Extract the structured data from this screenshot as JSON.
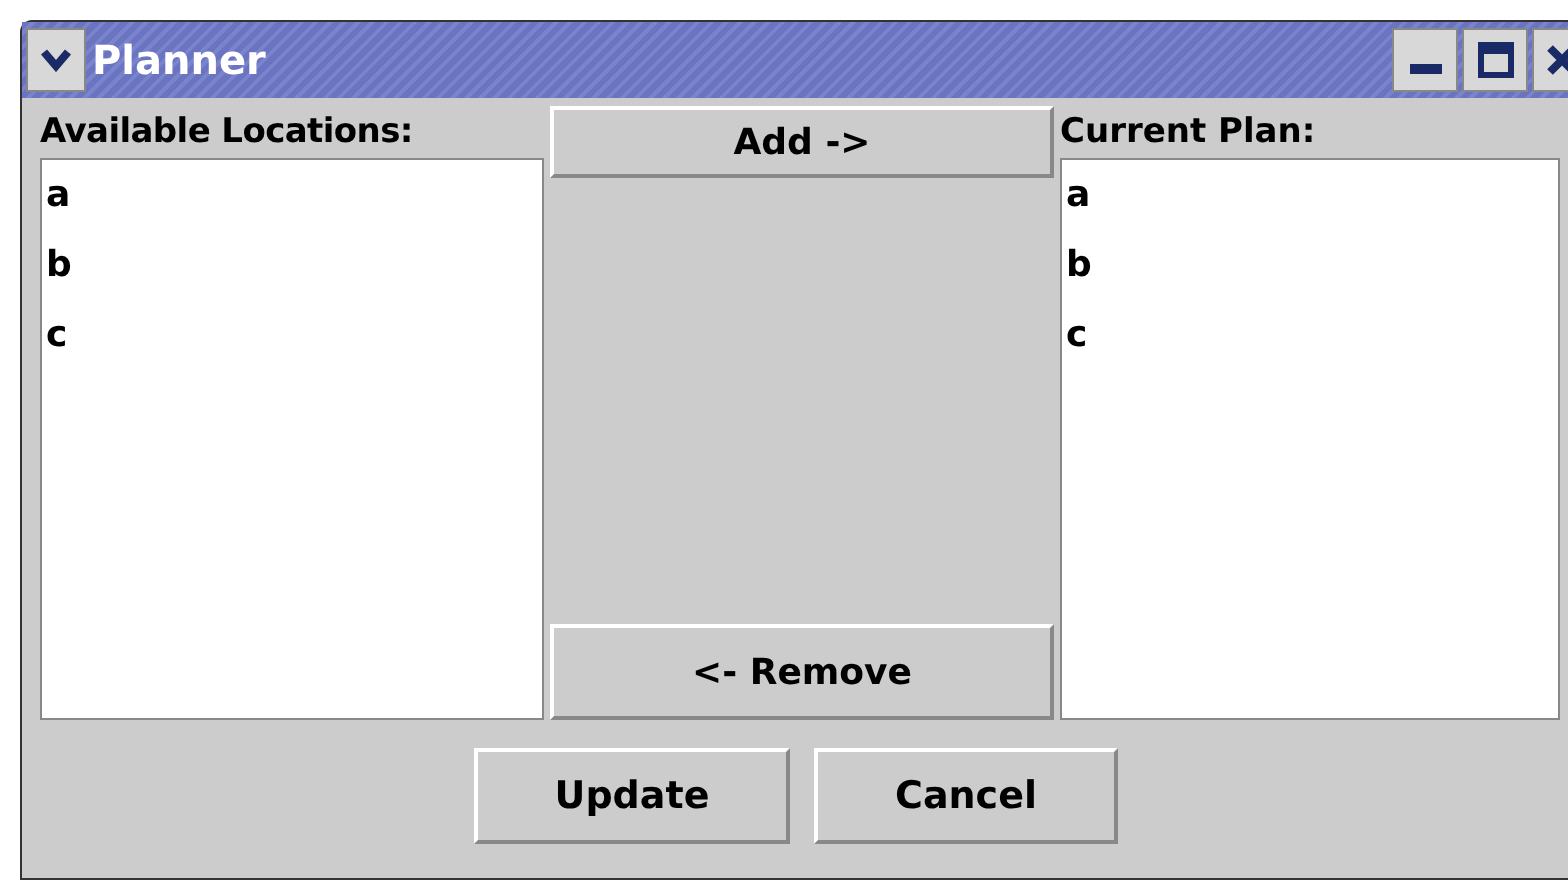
{
  "window": {
    "title": "Planner"
  },
  "available": {
    "label": "Available Locations:",
    "items": [
      "a",
      "b",
      "c"
    ]
  },
  "buttons": {
    "add": "Add ->",
    "remove": "<- Remove"
  },
  "current": {
    "label": "Current Plan:",
    "items": [
      "a",
      "b",
      "c"
    ]
  },
  "footer_buttons": [
    "Update",
    "Cancel"
  ]
}
